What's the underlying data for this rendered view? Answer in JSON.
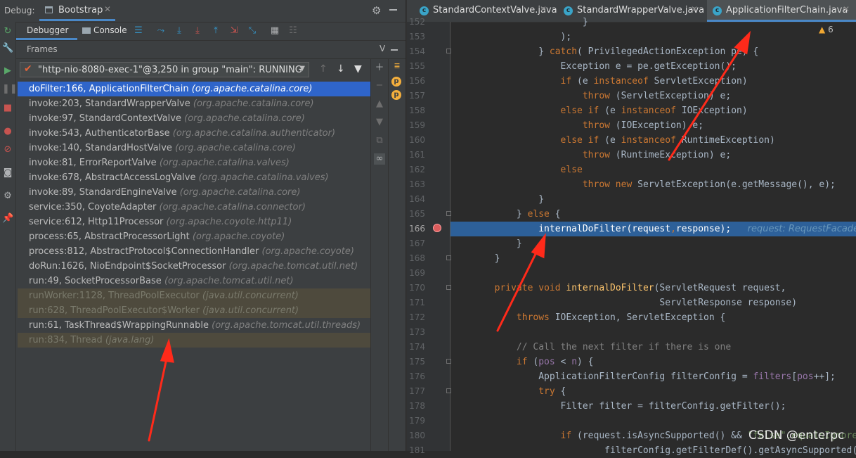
{
  "debug": {
    "label": "Debug:",
    "config_tab": "Bootstrap",
    "tabs": {
      "debugger": "Debugger",
      "console": "Console"
    },
    "frames_title": "Frames",
    "frames_toggle": "V",
    "thread": "\"http-nio-8080-exec-1\"@3,250 in group \"main\": RUNNING"
  },
  "frames": [
    {
      "method": "doFilter:166, ApplicationFilterChain",
      "pkg": "(org.apache.catalina.core)"
    },
    {
      "method": "invoke:203, StandardWrapperValve",
      "pkg": "(org.apache.catalina.core)"
    },
    {
      "method": "invoke:97, StandardContextValve",
      "pkg": "(org.apache.catalina.core)"
    },
    {
      "method": "invoke:543, AuthenticatorBase",
      "pkg": "(org.apache.catalina.authenticator)"
    },
    {
      "method": "invoke:140, StandardHostValve",
      "pkg": "(org.apache.catalina.core)"
    },
    {
      "method": "invoke:81, ErrorReportValve",
      "pkg": "(org.apache.catalina.valves)"
    },
    {
      "method": "invoke:678, AbstractAccessLogValve",
      "pkg": "(org.apache.catalina.valves)"
    },
    {
      "method": "invoke:89, StandardEngineValve",
      "pkg": "(org.apache.catalina.core)"
    },
    {
      "method": "service:350, CoyoteAdapter",
      "pkg": "(org.apache.catalina.connector)"
    },
    {
      "method": "service:612, Http11Processor",
      "pkg": "(org.apache.coyote.http11)"
    },
    {
      "method": "process:65, AbstractProcessorLight",
      "pkg": "(org.apache.coyote)"
    },
    {
      "method": "process:812, AbstractProtocol$ConnectionHandler",
      "pkg": "(org.apache.coyote)"
    },
    {
      "method": "doRun:1626, NioEndpoint$SocketProcessor",
      "pkg": "(org.apache.tomcat.util.net)"
    },
    {
      "method": "run:49, SocketProcessorBase",
      "pkg": "(org.apache.tomcat.util.net)"
    },
    {
      "method": "runWorker:1128, ThreadPoolExecutor",
      "pkg": "(java.util.concurrent)"
    },
    {
      "method": "run:628, ThreadPoolExecutor$Worker",
      "pkg": "(java.util.concurrent)"
    },
    {
      "method": "run:61, TaskThread$WrappingRunnable",
      "pkg": "(org.apache.tomcat.util.threads)"
    },
    {
      "method": "run:834, Thread",
      "pkg": "(java.lang)"
    }
  ],
  "editor": {
    "tabs": [
      "StandardContextValve.java",
      "StandardWrapperValve.java",
      "ApplicationFilterChain.java"
    ],
    "warnings": "6",
    "line_numbers": [
      "152",
      "153",
      "154",
      "155",
      "156",
      "157",
      "158",
      "159",
      "160",
      "161",
      "162",
      "163",
      "164",
      "165",
      "166",
      "167",
      "168",
      "169",
      "170",
      "171",
      "172",
      "173",
      "174",
      "175",
      "176",
      "177",
      "178",
      "179",
      "180",
      "181"
    ],
    "code": {
      "l152": "                        }",
      "l153": "                    );",
      "l154a": "                } ",
      "l154b": "catch",
      "l154c": "( PrivilegedActionException pe) {",
      "l155": "                    Exception e = pe.getException();",
      "l156a": "                    ",
      "l156b": "if",
      "l156c": " (e ",
      "l156d": "instanceof",
      "l156e": " ServletException)",
      "l157a": "                        ",
      "l157b": "throw",
      "l157c": " (ServletException) e;",
      "l158a": "                    ",
      "l158b": "else if",
      "l158c": " (e ",
      "l158d": "instanceof",
      "l158e": " IOException)",
      "l159a": "                        ",
      "l159b": "throw",
      "l159c": " (IOException) e;",
      "l160a": "                    ",
      "l160b": "else if",
      "l160c": " (e ",
      "l160d": "instanceof",
      "l160e": " RuntimeException)",
      "l161a": "                        ",
      "l161b": "throw",
      "l161c": " (RuntimeException) e;",
      "l162a": "                    ",
      "l162b": "else",
      "l163a": "                        ",
      "l163b": "throw new",
      "l163c": " ServletException(e.getMessage(), e);",
      "l164": "                }",
      "l165a": "            } ",
      "l165b": "else",
      "l165c": " {",
      "l166a": "                internalDoFilter(request",
      "l166b": ",",
      "l166c": "response);   ",
      "l166d": "request: RequestFacade",
      "l167": "            }",
      "l168": "        }",
      "l170a": "        ",
      "l170b": "private void",
      "l170c": " ",
      "l170d": "internalDoFilter",
      "l170e": "(ServletRequest request,",
      "l171": "                                      ServletResponse response)",
      "l172a": "            ",
      "l172b": "throws",
      "l172c": " IOException, ServletException {",
      "l174": "            // Call the next filter if there is one",
      "l175a": "            ",
      "l175b": "if",
      "l175c": " (",
      "l175d": "pos",
      "l175e": " < ",
      "l175f": "n",
      "l175g": ") {",
      "l176a": "                ApplicationFilterConfig filterConfig = ",
      "l176b": "filters",
      "l176c": "[",
      "l176d": "pos",
      "l176e": "++];",
      "l177a": "                ",
      "l177b": "try",
      "l177c": " {",
      "l178": "                    Filter filter = filterConfig.getFilter();",
      "l180a": "                    ",
      "l180b": "if",
      "l180c": " (request.isAsyncSupported() && ",
      "l180d": "\"false\".equalsIgnoreCase(",
      "l181": "                            filterConfig.getFilterDef().getAsyncSupported())) {"
    }
  },
  "watermark": "CSDN @enterpc",
  "colors": {
    "accent": "#4a88c7",
    "selected_frame": "#2f65ca",
    "exec_line": "#2d6099",
    "annotation_arrow": "#ff2a1a"
  }
}
